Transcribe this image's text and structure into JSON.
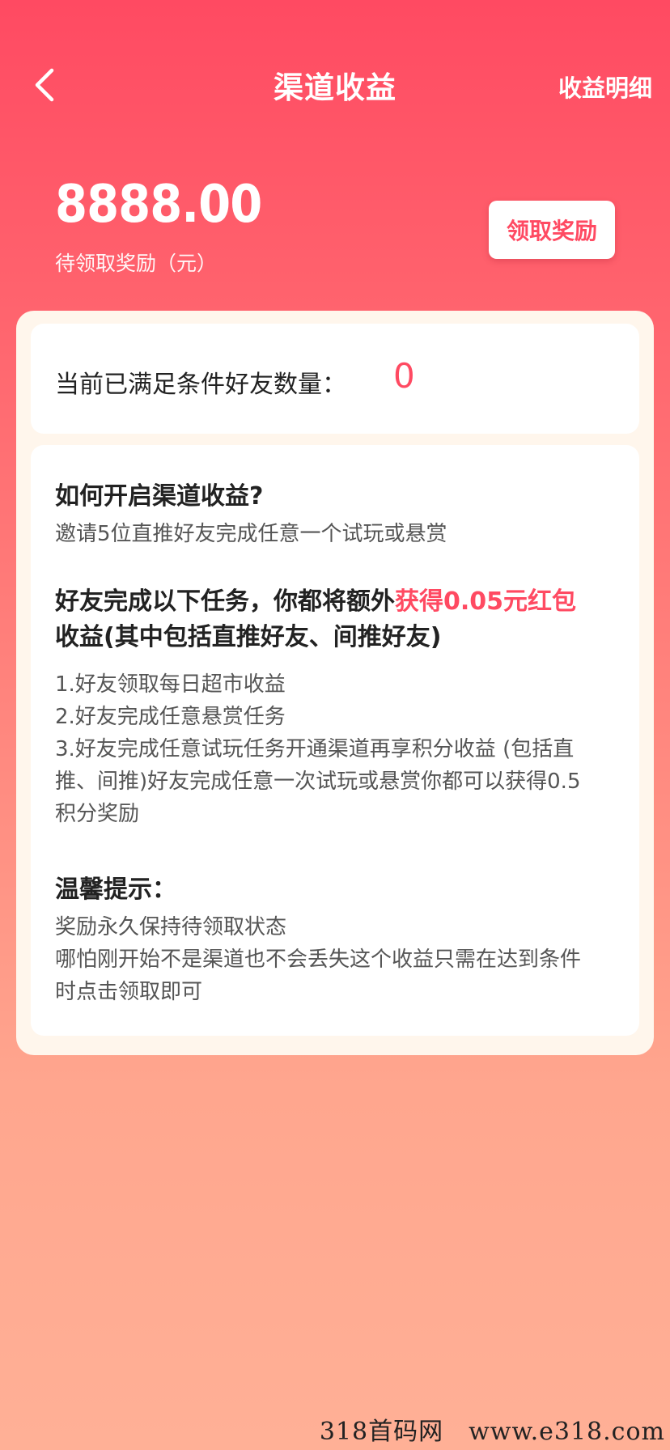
{
  "nav": {
    "title": "渠道收益",
    "right_link": "收益明细",
    "back_icon": "chevron-left-icon"
  },
  "reward": {
    "amount": "8888.00",
    "label": "待领取奖励（元）",
    "claim_button": "领取奖励"
  },
  "friends": {
    "label": "当前已满足条件好友数量：",
    "count": "0"
  },
  "info": {
    "how_title": "如何开启渠道收益?",
    "how_desc": "邀请5位直推好友完成任意一个试玩或悬赏",
    "task_title_part1": "好友完成以下任务，你都将额外",
    "task_title_highlight": "获得0.05元红包",
    "task_title_part2": "收益(其中包括直推好友、间推好友)",
    "tasks": [
      "1.好友领取每日超市收益",
      "2.好友完成任意悬赏任务",
      "3.好友完成任意试玩任务开通渠道再享积分收益 (包括直",
      "推、间推)好友完成任意一次试玩或悬赏你都可以获得0.5",
      "积分奖励"
    ],
    "tip_title": "温馨提示：",
    "tips": [
      "奖励永久保持待领取状态",
      "哪怕刚开始不是渠道也不会丢失这个收益只需在达到条件",
      "时点击领取即可"
    ]
  },
  "watermark": "318首码网　www.e318.com",
  "colors": {
    "accent": "#ff4a62",
    "panel_bg": "#fff6ec"
  }
}
